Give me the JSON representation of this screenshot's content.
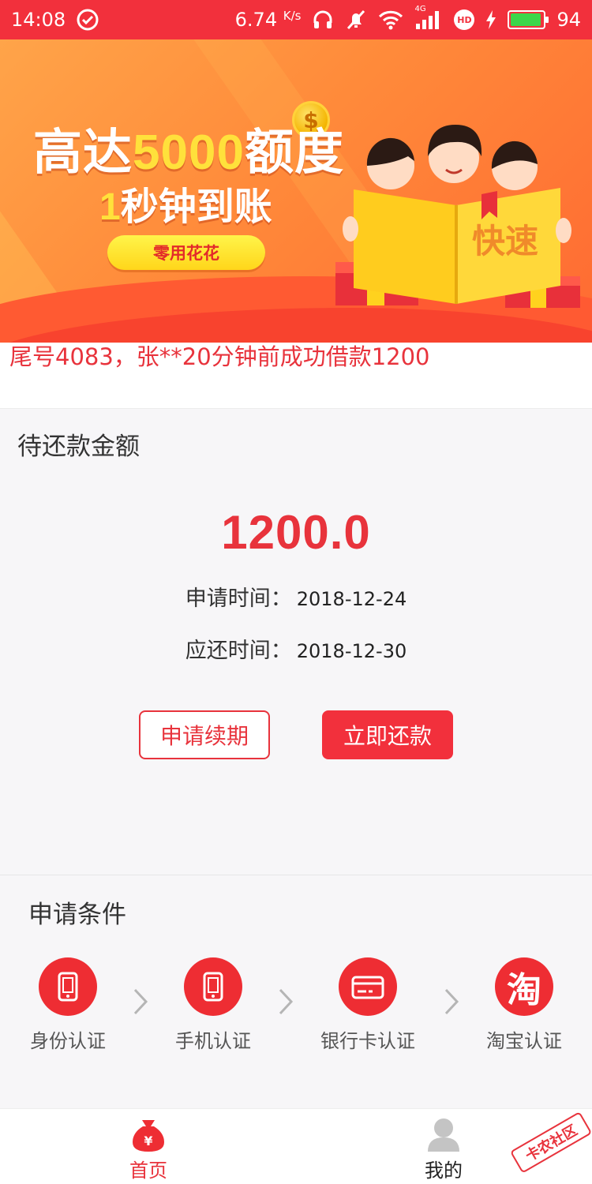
{
  "status_bar": {
    "time": "14:08",
    "net_speed": "6.74",
    "net_unit": "K/s",
    "battery": "94",
    "signal_label": "4G",
    "hd_label": "HD",
    "battery_level": 0.94,
    "bar_color": "#f2303c"
  },
  "banner": {
    "headline_prefix": "高达",
    "headline_highlight": "5000",
    "headline_suffix": "额度",
    "sub_highlight": "1",
    "sub_text": "秒钟到账",
    "button_label": "零用花花",
    "book_text": "快速",
    "coin_symbol": "$"
  },
  "ticker": {
    "text": "尾号4083，张**20分钟前成功借款1200"
  },
  "repayment": {
    "title": "待还款金额",
    "amount": "1200.0",
    "apply_label": "申请时间：",
    "apply_date": "2018-12-24",
    "due_label": "应还时间：",
    "due_date": "2018-12-30",
    "extend_label": "申请续期",
    "repay_label": "立即还款"
  },
  "conditions": {
    "title": "申请条件",
    "items": [
      {
        "label": "身份认证",
        "icon": "phone-icon"
      },
      {
        "label": "手机认证",
        "icon": "phone-icon"
      },
      {
        "label": "银行卡认证",
        "icon": "bank-card-icon"
      },
      {
        "label": "淘宝认证",
        "icon": "taobao-icon",
        "glyph": "淘"
      }
    ]
  },
  "tabbar": {
    "home_label": "首页",
    "home_icon_glyph": "¥",
    "mine_label": "我的"
  },
  "watermark": {
    "text": "卡农社区"
  },
  "colors": {
    "accent": "#e8333c",
    "banner_orange": "#ff8a3a",
    "highlight_yellow": "#ffe13b"
  }
}
